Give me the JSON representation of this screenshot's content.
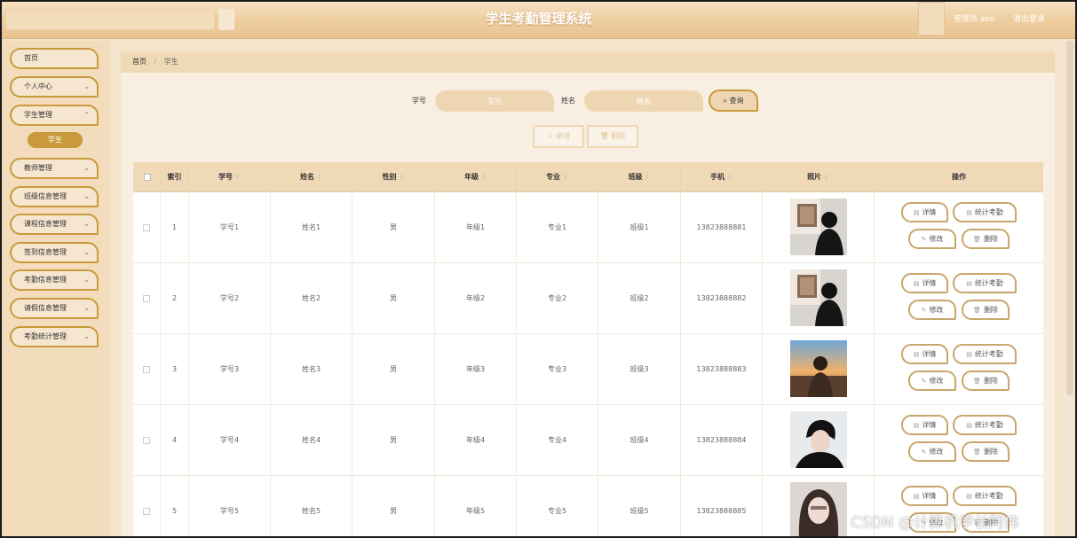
{
  "header": {
    "title": "学生考勤管理系统",
    "user_label": "管理员 abo",
    "logout_label": "退出登录"
  },
  "sidebar": {
    "items": [
      {
        "label": "首页",
        "expandable": false
      },
      {
        "label": "个人中心",
        "expandable": true
      },
      {
        "label": "学生管理",
        "expandable": true,
        "active_sub": "学生"
      },
      {
        "label": "教师管理",
        "expandable": true
      },
      {
        "label": "班级信息管理",
        "expandable": true
      },
      {
        "label": "课程信息管理",
        "expandable": true
      },
      {
        "label": "签到信息管理",
        "expandable": true
      },
      {
        "label": "考勤信息管理",
        "expandable": true
      },
      {
        "label": "请假信息管理",
        "expandable": true
      },
      {
        "label": "考勤统计管理",
        "expandable": true
      }
    ],
    "chevron": "⌄"
  },
  "breadcrumb": {
    "home": "首页",
    "separator": "/",
    "current": "学生"
  },
  "search": {
    "id_label": "学号",
    "id_placeholder": "学号",
    "name_label": "姓名",
    "name_placeholder": "姓名",
    "query_label": "查询",
    "query_icon": "search-icon"
  },
  "toolbar": {
    "add_label": "新增",
    "add_icon": "plus-icon",
    "delete_label": "删除",
    "delete_icon": "trash-icon"
  },
  "table": {
    "columns": [
      "索引",
      "学号",
      "姓名",
      "性别",
      "年级",
      "专业",
      "班级",
      "手机",
      "照片",
      "操作"
    ],
    "sortable": [
      false,
      true,
      true,
      true,
      true,
      true,
      true,
      true,
      true,
      false
    ],
    "rows": [
      {
        "index": "1",
        "id": "学号1",
        "name": "姓名1",
        "gender": "男",
        "grade": "年级1",
        "major": "专业1",
        "class": "班级1",
        "phone": "13823888881",
        "photo": "photo-back-man"
      },
      {
        "index": "2",
        "id": "学号2",
        "name": "姓名2",
        "gender": "男",
        "grade": "年级2",
        "major": "专业2",
        "class": "班级2",
        "phone": "13823888882",
        "photo": "photo-back-man"
      },
      {
        "index": "3",
        "id": "学号3",
        "name": "姓名3",
        "gender": "男",
        "grade": "年级3",
        "major": "专业3",
        "class": "班级3",
        "phone": "13823888883",
        "photo": "photo-sunset-man"
      },
      {
        "index": "4",
        "id": "学号4",
        "name": "姓名4",
        "gender": "男",
        "grade": "年级4",
        "major": "专业4",
        "class": "班级4",
        "phone": "13823888884",
        "photo": "photo-portrait-man"
      },
      {
        "index": "5",
        "id": "学号5",
        "name": "姓名5",
        "gender": "男",
        "grade": "年级5",
        "major": "专业5",
        "class": "班级5",
        "phone": "13823888885",
        "photo": "photo-portrait-woman"
      }
    ],
    "actions": {
      "detail": "详情",
      "stats": "统计考勤",
      "edit": "修改",
      "delete": "删除"
    }
  },
  "watermark": "CSDN @计算机学长阿伟",
  "colors": {
    "accent": "#c99a3b",
    "header_bg": "#eecd9f",
    "sidebar_bg": "#f2dcbc",
    "table_head_bg": "#f0d9b6"
  }
}
